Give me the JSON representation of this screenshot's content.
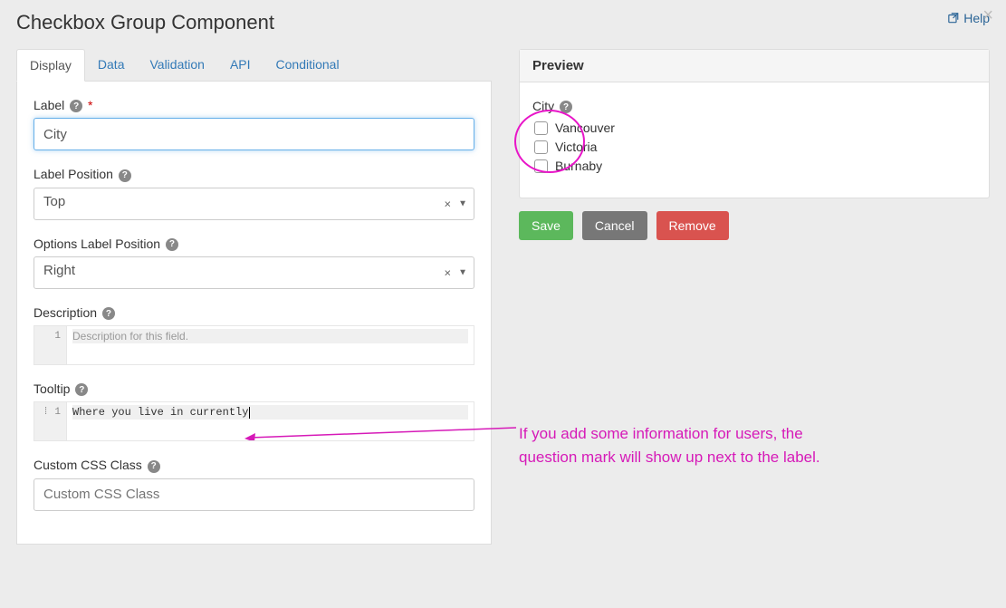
{
  "header": {
    "title": "Checkbox Group Component",
    "help_label": "Help"
  },
  "tabs": [
    "Display",
    "Data",
    "Validation",
    "API",
    "Conditional"
  ],
  "active_tab": "Display",
  "form": {
    "label": {
      "caption": "Label",
      "required": true,
      "value": "City"
    },
    "label_position": {
      "caption": "Label Position",
      "value": "Top"
    },
    "options_label_position": {
      "caption": "Options Label Position",
      "value": "Right"
    },
    "description": {
      "caption": "Description",
      "gutter": "1",
      "placeholder": "Description for this field."
    },
    "tooltip": {
      "caption": "Tooltip",
      "gutter": "1",
      "value": "Where you live in currently"
    },
    "custom_css": {
      "caption": "Custom CSS Class",
      "placeholder": "Custom CSS Class"
    }
  },
  "preview": {
    "heading": "Preview",
    "field_label": "City",
    "options": [
      "Vancouver",
      "Victoria",
      "Burnaby"
    ]
  },
  "buttons": {
    "save": "Save",
    "cancel": "Cancel",
    "remove": "Remove"
  },
  "annotation": {
    "line1": "If you add some information for users, the",
    "line2": "question mark will show up next to the label."
  }
}
